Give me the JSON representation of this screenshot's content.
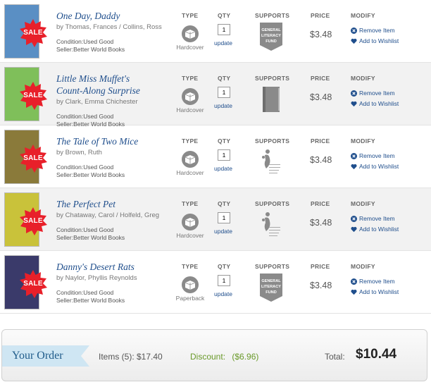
{
  "columns": {
    "type": "TYPE",
    "qty": "QTY",
    "supports": "SUPPORTS",
    "price": "PRICE",
    "modify": "MODIFY"
  },
  "sale_badge": "SALE",
  "actions": {
    "update": "update",
    "remove": "Remove Item",
    "wishlist": "Add to Wishlist"
  },
  "items": [
    {
      "title_lines": [
        "One Day, Daddy"
      ],
      "author": "by Thomas, Frances / Collins, Ross",
      "condition": "Condition:Used Good",
      "seller": "Seller:Better World Books",
      "type": "Hardcover",
      "qty": "1",
      "supports": "general-literacy-fund-icon",
      "supports_text": [
        "GENERAL",
        "LITERACY",
        "FUND"
      ],
      "price": "$3.48",
      "cover_color": "#5a8fc4"
    },
    {
      "title_lines": [
        "Little Miss Muffet's",
        "Count-Along Surprise"
      ],
      "author": "by Clark, Emma Chichester",
      "condition": "Condition:Used Good",
      "seller": "Seller:Better World Books",
      "type": "Hardcover",
      "qty": "1",
      "supports": "book-icon",
      "price": "$3.48",
      "cover_color": "#7fbf5a"
    },
    {
      "title_lines": [
        "The Tale of Two Mice"
      ],
      "author": "by Brown, Ruth",
      "condition": "Condition:Used Good",
      "seller": "Seller:Better World Books",
      "type": "Hardcover",
      "qty": "1",
      "supports": "national-center-family-literacy-icon",
      "price": "$3.48",
      "cover_color": "#8a7a3a"
    },
    {
      "title_lines": [
        "The Perfect Pet"
      ],
      "author": "by Chataway, Carol / Holfeld, Greg",
      "condition": "Condition:Used Good",
      "seller": "Seller:Better World Books",
      "type": "Hardcover",
      "qty": "1",
      "supports": "national-center-family-literacy-icon",
      "price": "$3.48",
      "cover_color": "#c9c23a"
    },
    {
      "title_lines": [
        "Danny's Desert Rats"
      ],
      "author": "by Naylor, Phyllis Reynolds",
      "condition": "Condition:Used Good",
      "seller": "Seller:Better World Books",
      "type": "Paperback",
      "qty": "1",
      "supports": "general-literacy-fund-icon",
      "supports_text": [
        "GENERAL",
        "LITERACY",
        "FUND"
      ],
      "price": "$3.48",
      "cover_color": "#3a3a6a"
    }
  ],
  "order": {
    "heading": "Your Order",
    "items_summary": "Items (5): $17.40",
    "discount_label": "Discount:",
    "discount_value": "($6.96)",
    "total_label": "Total:",
    "total_value": "$10.44"
  },
  "colors": {
    "link": "#1f4e8c",
    "sale": "#e8202a",
    "discount": "#6a9a2a",
    "ribbon": "#cfe6f3"
  }
}
